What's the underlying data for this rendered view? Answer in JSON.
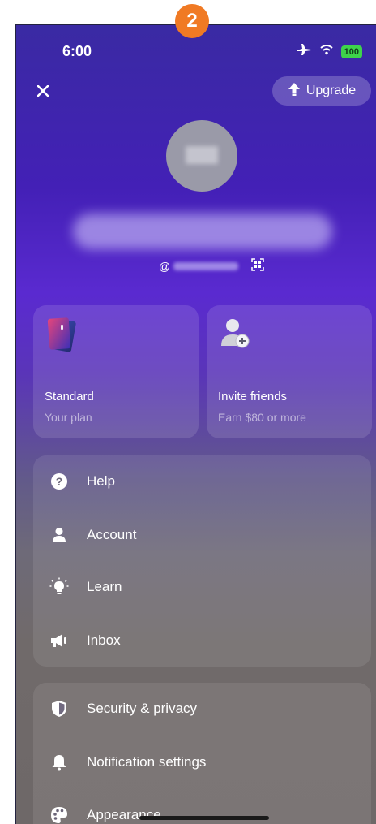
{
  "step_badge": "2",
  "status_bar": {
    "time": "6:00",
    "battery": "100"
  },
  "header": {
    "upgrade_label": "Upgrade"
  },
  "profile": {
    "handle_prefix": "@"
  },
  "tiles": [
    {
      "title": "Standard",
      "subtitle": "Your plan"
    },
    {
      "title": "Invite friends",
      "subtitle": "Earn $80 or more"
    }
  ],
  "menu_group_1": [
    {
      "label": "Help",
      "icon": "question-circle-icon"
    },
    {
      "label": "Account",
      "icon": "person-icon"
    },
    {
      "label": "Learn",
      "icon": "lightbulb-icon"
    },
    {
      "label": "Inbox",
      "icon": "megaphone-icon"
    }
  ],
  "menu_group_2": [
    {
      "label": "Security & privacy",
      "icon": "shield-icon"
    },
    {
      "label": "Notification settings",
      "icon": "bell-icon"
    },
    {
      "label": "Appearance",
      "icon": "palette-icon"
    }
  ],
  "colors": {
    "accent_purple": "#4a24c0",
    "badge_orange": "#f07a24",
    "battery_green": "#3ed34b"
  }
}
